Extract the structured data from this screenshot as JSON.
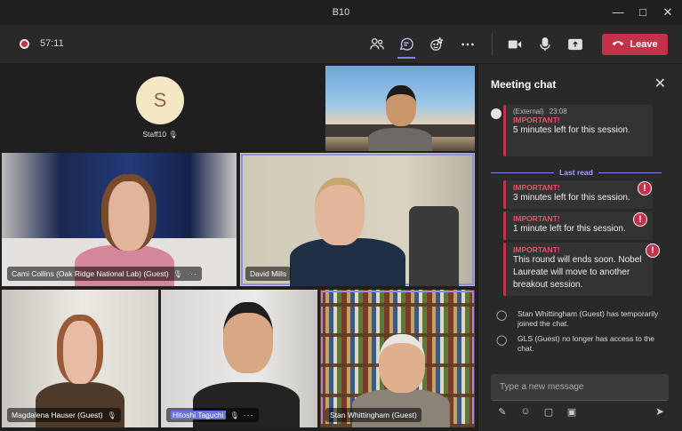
{
  "window": {
    "title": "B10"
  },
  "toolbar": {
    "timer": "57:11",
    "leave_label": "Leave"
  },
  "participants": [
    {
      "name": "Staff10",
      "initial": "S"
    },
    {
      "name": "Cami Collins (Oak Ridge National Lab) (Guest)"
    },
    {
      "name": "David Mills"
    },
    {
      "name": "Magdalena Hauser (Guest)"
    },
    {
      "name": "Hitoshi Taguchi"
    },
    {
      "name": "Stan Whittingham (Guest)"
    }
  ],
  "chat": {
    "title": "Meeting chat",
    "last_read_label": "Last read",
    "compose_placeholder": "Type a new message",
    "messages": [
      {
        "sender": "(External)",
        "time": "23:08",
        "label": "IMPORTANT!",
        "text": "5 minutes left for this session."
      },
      {
        "label": "IMPORTANT!",
        "text": "3 minutes left for this session."
      },
      {
        "label": "IMPORTANT!",
        "text": "1 minute left for this session."
      },
      {
        "label": "IMPORTANT!",
        "text": "This round will ends soon. Nobel Laureate will move to another breakout session."
      }
    ],
    "system": [
      {
        "text": "Stan Whittingham (Guest) has temporarily joined the chat."
      },
      {
        "text": "GLS (Guest) no longer has access to the chat."
      }
    ]
  },
  "colors": {
    "accent": "#7f85f5",
    "leave": "#c4314b",
    "important": "#e3556b"
  }
}
